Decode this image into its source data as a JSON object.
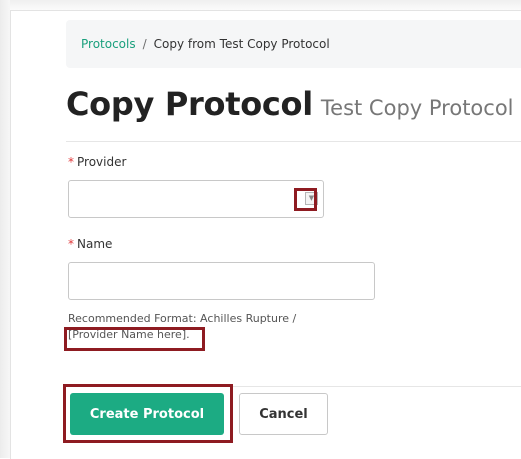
{
  "breadcrumb": {
    "root_label": "Protocols",
    "separator": "/",
    "current_label": "Copy from Test Copy Protocol"
  },
  "header": {
    "title": "Copy Protocol",
    "subtitle": "Test Copy Protocol"
  },
  "form": {
    "provider": {
      "required_marker": "*",
      "label": "Provider",
      "value": ""
    },
    "name": {
      "required_marker": "*",
      "label": "Name",
      "value": "",
      "help_line1": "Recommended Format: Achilles Rupture /",
      "help_line2": "[Provider Name here]."
    }
  },
  "actions": {
    "create_label": "Create Protocol",
    "cancel_label": "Cancel"
  },
  "colors": {
    "accent": "#1cab83",
    "link": "#1aa07d",
    "required": "#e0383a",
    "highlight": "#8e1b21"
  }
}
